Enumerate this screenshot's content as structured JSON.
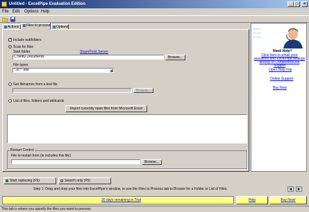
{
  "window": {
    "title": "Untitled - ExcelPipe Evaluation Edition"
  },
  "menu": [
    "File",
    "Edit",
    "Options",
    "Help"
  ],
  "tabs": [
    "Actions",
    "Files to process",
    "Options"
  ],
  "files_tab": {
    "include_subfolders": "Include subfolders",
    "include_subfolders_checked": true,
    "scan_label": "Scan for files",
    "start_folder_label": "Start folder",
    "sharepoint_link": "SharePoint Server",
    "start_folder_value": "C:\\Mitty Documents",
    "browse_label": "Browse...",
    "file_types_label": "File types",
    "file_types_value": "*.xl*;*.ods",
    "text_file_label": "Get filenames from a text file",
    "text_browse_label": "Browse...",
    "list_label": "List of files, folders and wildcards",
    "import_button": "Import currently open files from Microsoft Excel",
    "restart_group": "Restart Control",
    "restart_label": "File to restart from (ie includes this file)",
    "restart_browse_label": "Browse..."
  },
  "actions": {
    "replace_button": "Start replacing (F9)",
    "search_button": "Search only (F5)"
  },
  "sidebar": {
    "need_help": "Need Help?",
    "help_text": "Click here to email your questions and ExcelPipe settings directly to ComponentOne Support",
    "links": [
      "Open Help File",
      "Online Support",
      "Buy Now"
    ]
  },
  "step_text": "Step 1: Drag and drop your files into ExcelPipe's window, or use the Files to Process tab to Browse for a Folder or List of Files.",
  "trial_text": "30 days remaining in Trial",
  "help_button": "Help",
  "buy_button": "Buy Now!",
  "status_text": "This tab is where you specify the files you want to process"
}
